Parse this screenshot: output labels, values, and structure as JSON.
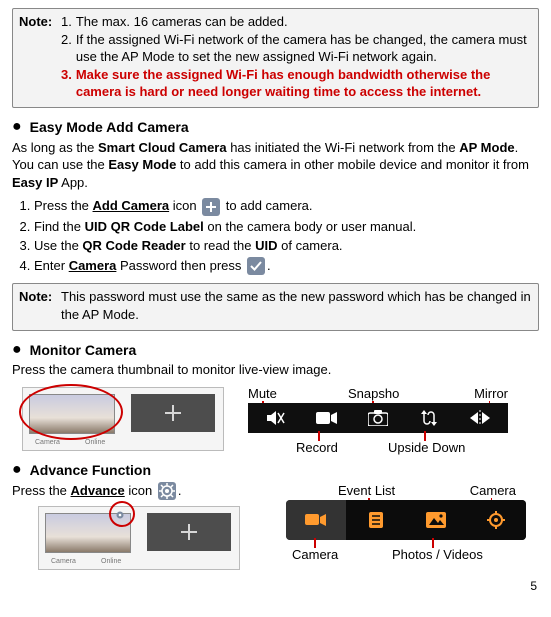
{
  "note1": {
    "lead": "Note:",
    "l1_num": "1.",
    "l1_txt": "The max. 16 cameras can be added.",
    "l2_num": "2.",
    "l2_txt": "If the assigned Wi-Fi network of the camera has be changed, the camera must use the AP Mode to set the new assigned Wi-Fi network again.",
    "l3_num": "3.",
    "l3_txt": "Make sure the assigned Wi-Fi has enough bandwidth otherwise the camera is hard or need longer waiting time to access the internet."
  },
  "sectionA": {
    "title": "Easy Mode Add Camera",
    "p1a": "As long as the ",
    "p1b": "Smart Cloud Camera",
    "p1c": " has initiated the Wi-Fi network from the ",
    "p1d": "AP Mode",
    "p1e": ".   You can use the ",
    "p1f": "Easy Mode",
    "p1g": " to add this camera in other mobile device and monitor it from ",
    "p1h": "Easy IP",
    "p1i": " App."
  },
  "stepsA": {
    "s1a": "Press the ",
    "s1b": "Add Camera",
    "s1c": " icon ",
    "s1d": " to add camera.",
    "s2a": "Find the ",
    "s2b": "UID QR Code Label",
    "s2c": " on the camera body or user manual.",
    "s3a": "Use the ",
    "s3b": "QR Code Reader",
    "s3c": " to read the ",
    "s3d": "UID",
    "s3e": " of camera.",
    "s4a": "Enter ",
    "s4b": "Camera",
    "s4c": " Password then press ",
    "s4d": "."
  },
  "note2": {
    "lead": "Note:",
    "txt": "This password must use the same as the new password which has be changed in the AP Mode."
  },
  "sectionB": {
    "title": "Monitor Camera",
    "p": "Press the camera thumbnail to monitor live-view image."
  },
  "tbar1": {
    "top1": "Mute",
    "top2": "Snapsho",
    "top3": "Mirror",
    "bot1": "Record",
    "bot2": "Upside Down"
  },
  "sectionC": {
    "title": "Advance Function",
    "p1": "Press the ",
    "p2": "Advance",
    "p3": " icon ",
    "p4": "."
  },
  "tbar2": {
    "top1": "Event List",
    "top2": "Camera",
    "bot1": "Camera",
    "bot2": "Photos / Videos"
  },
  "thumb": {
    "l1": "Camera",
    "l2": "Online"
  },
  "page": "5"
}
